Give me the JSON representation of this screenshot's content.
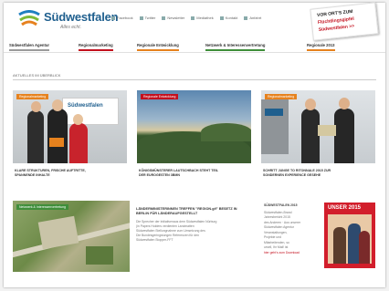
{
  "header": {
    "logo_text": "Südwestfalen",
    "logo_sub": "Alles echt.",
    "links": [
      "Facebook",
      "Twitter",
      "Newsletter",
      "Mediathek",
      "Kontakt",
      "Anfahrt"
    ],
    "promo": [
      "VOR ORT'S ZUM",
      "Flüchtlingsgipfel",
      "Südwestfalen >>"
    ]
  },
  "nav": [
    {
      "label": "Südwestfalen Agentur",
      "color": "#9b9b9b"
    },
    {
      "label": "Regionalmarketing",
      "color": "#c3101e"
    },
    {
      "label": "Regionale Entwicklung",
      "color": "#e6821e"
    },
    {
      "label": "Netzwerk & Interessenvertretung",
      "color": "#3f8e3a"
    },
    {
      "label": "Regionale 2013",
      "color": "#e6821e"
    }
  ],
  "section_title": "AKTUELLES IM ÜBERBLICK",
  "cards": [
    {
      "tag": "Regionalmarketing",
      "tag_color": "#e6821e",
      "title": [
        "KLARE STRUKTUREN, FRISCHE AUFTRITTE,",
        "SPANNENDE INHALTE"
      ]
    },
    {
      "tag": "Regionale Entwicklung",
      "tag_color": "#c3101e",
      "title": [
        "KÖNIGSMÜNSTERER LAUTSCHBACH STEHT TEIL",
        "DER EUROGESTEN 3BMN"
      ]
    },
    {
      "tag": "Regionalmarketing",
      "tag_color": "#e6821e",
      "title": [
        "SCHRITT JUNGE TO RITONNALE 2015 ZUR",
        "SONDERNEN EXPERIENCE GESEHE"
      ]
    }
  ],
  "feature": {
    "tag": "Netzwerk & Interessenvertretung",
    "tag_color": "#3f8e3a",
    "title": [
      "LÄNDERMINISTERINNEN TREFFEN \"REGION.gif\" BESETZ IN",
      "BERLIN FÜR LÄNDERAUFGESTELLT"
    ],
    "body": [
      "Die Sprecher der Initiativenaus dem Südwestfalen Nürburg",
      "(in Papers Holders verdienten Landmatten",
      "Südwestfalen Stellungnahme zum Umsetzung des",
      "Die Bundesgeringstungen Referenzen für den",
      "Südwestfalen Stopper-FFT"
    ]
  },
  "sidebar": {
    "heading": "SÜDWESTFALEN 2015",
    "lines": [
      "Südwestfalen-Brand",
      "Jahresbericht 2015",
      "des Anderen · Aus unserer",
      "Südwestfalen Agentur",
      "Veranstaltungen,",
      "Projekte und",
      "Mitarbeitenden, so",
      "ursell, Ihr Mail! ist"
    ],
    "link": "hier geht's zum Download"
  },
  "magazine": {
    "title": "UNSER 2015"
  }
}
